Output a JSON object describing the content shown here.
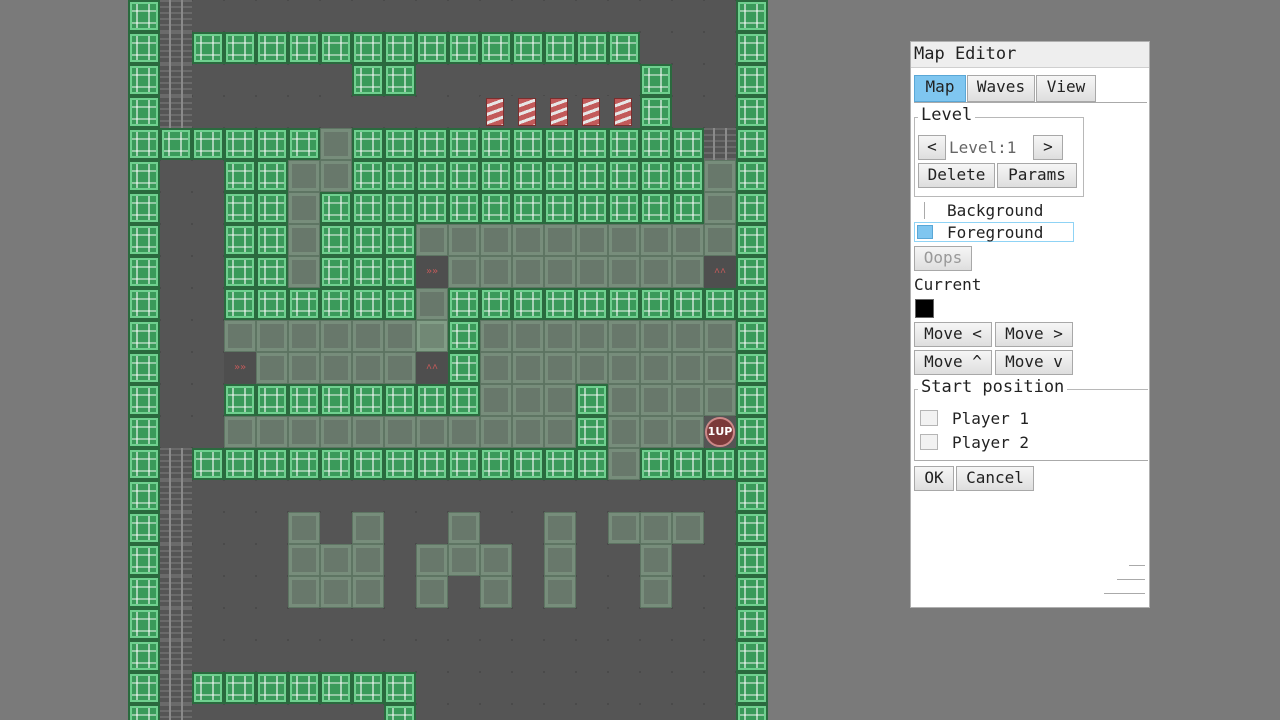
{
  "editor": {
    "title": "Map Editor",
    "tabs": [
      {
        "label": "Map",
        "active": true
      },
      {
        "label": "Waves",
        "active": false
      },
      {
        "label": "View",
        "active": false
      }
    ],
    "level_group_title": "Level",
    "prev_label": "<",
    "level_value": "Level:1",
    "next_label": ">",
    "delete_label": "Delete",
    "params_label": "Params",
    "layers": {
      "background": "Background",
      "foreground": "Foreground",
      "selected": "Foreground"
    },
    "oops_label": "Oops",
    "current_label": "Current",
    "current_color": "#000000",
    "move_left": "Move <",
    "move_right": "Move >",
    "move_up": "Move ^",
    "move_down": "Move v",
    "start_group_title": "Start position",
    "player1": "Player 1",
    "player2": "Player 2",
    "ok_label": "OK",
    "cancel_label": "Cancel"
  },
  "map": {
    "oneup_label": "1UP",
    "colors": {
      "wall": "#3a9a5a",
      "floor": "#555555",
      "ghost": "#7a9680",
      "spring": "#c25a5a"
    }
  }
}
